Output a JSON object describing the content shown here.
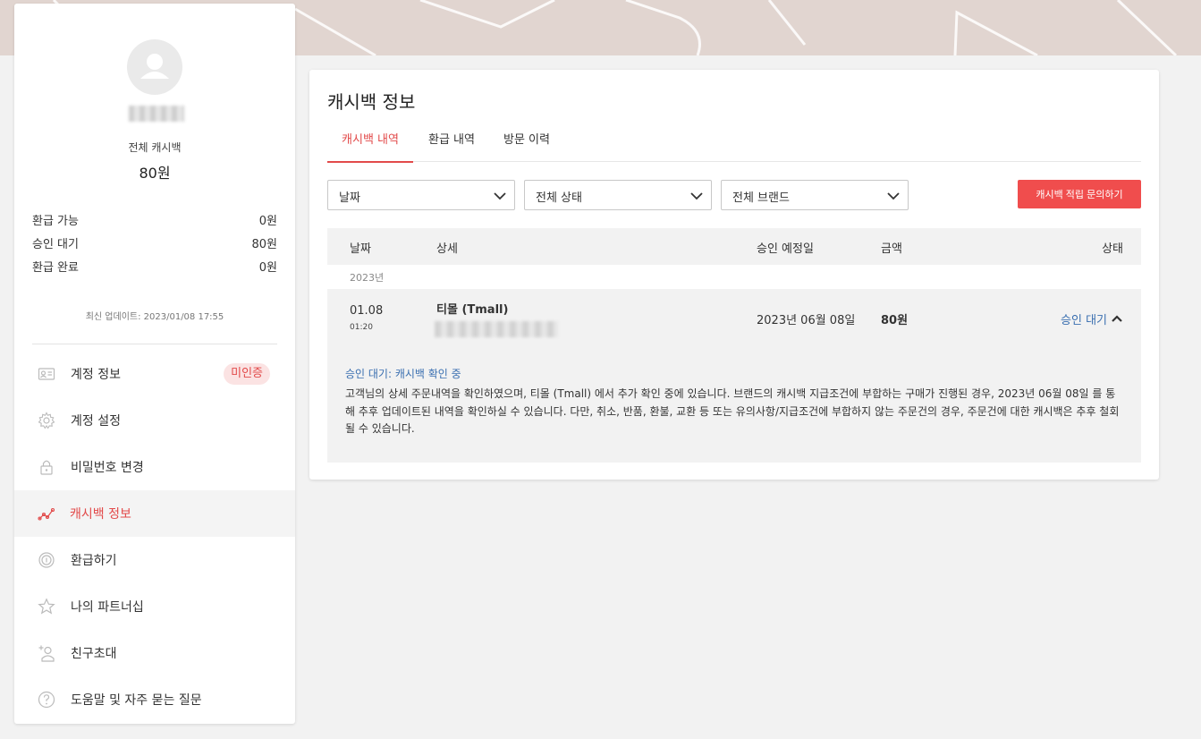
{
  "sidebar": {
    "total_label": "전체 캐시백",
    "total_value": "80원",
    "stats": [
      {
        "label": "환급 가능",
        "value": "0원"
      },
      {
        "label": "승인 대기",
        "value": "80원"
      },
      {
        "label": "환급 완료",
        "value": "0원"
      }
    ],
    "updated": "최신 업데이트: 2023/01/08 17:55",
    "menu": [
      {
        "label": "계정 정보",
        "icon": "id-card-icon",
        "badge": "미인증"
      },
      {
        "label": "계정 설정",
        "icon": "gear-icon"
      },
      {
        "label": "비밀번호 변경",
        "icon": "lock-icon"
      },
      {
        "label": "캐시백 정보",
        "icon": "chart-line-icon",
        "active": true
      },
      {
        "label": "환급하기",
        "icon": "coin-icon"
      },
      {
        "label": "나의 파트너십",
        "icon": "star-icon"
      },
      {
        "label": "친구초대",
        "icon": "add-user-icon"
      },
      {
        "label": "도움말 및 자주 묻는 질문",
        "icon": "question-icon"
      }
    ]
  },
  "main": {
    "title": "캐시백 정보",
    "tabs": [
      {
        "label": "캐시백 내역",
        "active": true
      },
      {
        "label": "환급 내역"
      },
      {
        "label": "방문 이력"
      }
    ],
    "filters": {
      "date": "날짜",
      "status": "전체 상태",
      "brand": "전체 브랜드"
    },
    "inquiry_button": "캐시백 적립 문의하기",
    "table": {
      "headers": {
        "date": "날짜",
        "detail": "상세",
        "expected": "승인 예정일",
        "amount": "금액",
        "status": "상태"
      },
      "year": "2023년",
      "rows": [
        {
          "date": "01.08",
          "time": "01:20",
          "brand": "티몰 (Tmall)",
          "expected": "2023년 06월 08일",
          "amount": "80원",
          "status": "승인 대기",
          "note_title": "승인 대기: 캐시백 확인 중",
          "note_text": "고객님의 상세 주문내역을 확인하였으며, 티몰 (Tmall) 에서 추가 확인 중에 있습니다. 브랜드의 캐시백 지급조건에 부합하는 구매가 진행된 경우, 2023년 06월 08일 를 통해 추후 업데이트된 내역을 확인하실 수 있습니다. 다만, 취소, 반품, 환불, 교환 등 또는 유의사항/지급조건에 부합하지 않는 주문건의 경우, 주문건에 대한 캐시백은 추후 철회될 수 있습니다."
        }
      ]
    }
  },
  "colors": {
    "accent": "#e24a4a",
    "button": "#f04d4d",
    "status_link": "#3a6fb0",
    "banner": "#e1d5d0"
  }
}
